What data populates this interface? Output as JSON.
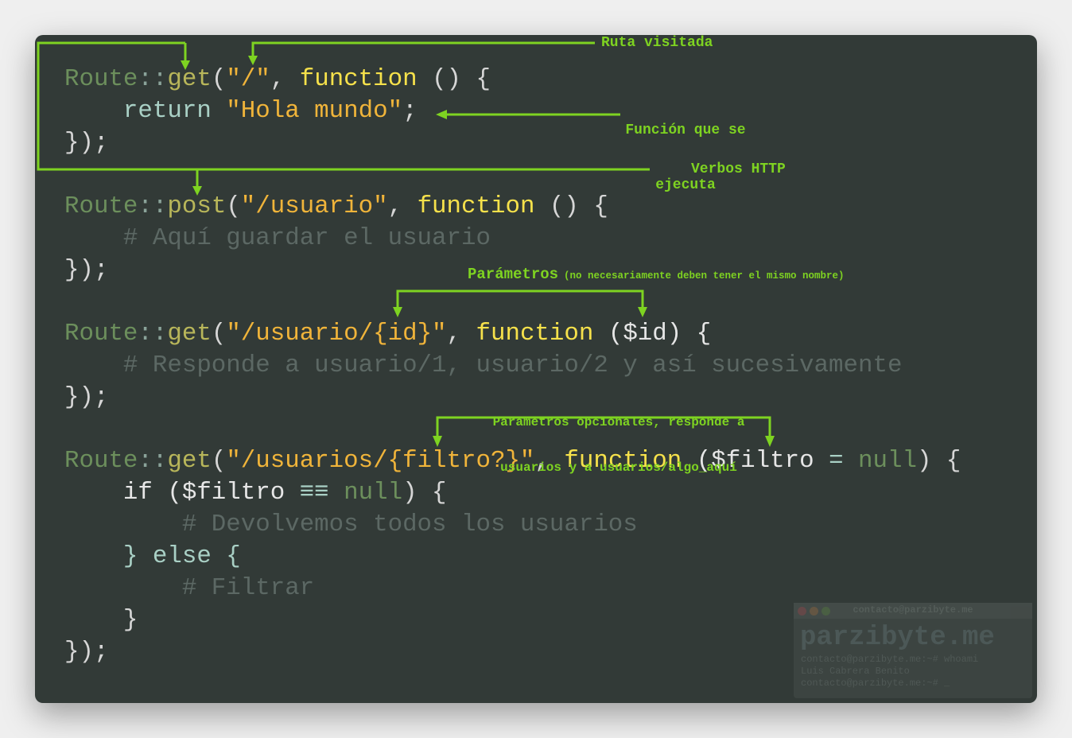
{
  "code_lines": [
    [
      [
        "Route",
        "route"
      ],
      [
        "::",
        "sep"
      ],
      [
        "get",
        "method"
      ],
      [
        "(",
        "punc"
      ],
      [
        "\"/\"",
        "str"
      ],
      [
        ", ",
        "punc"
      ],
      [
        "function",
        "kw"
      ],
      [
        " () {",
        "punc"
      ]
    ],
    [
      [
        "    return ",
        "ret"
      ],
      [
        "\"Hola mundo\"",
        "str"
      ],
      [
        ";",
        "punc"
      ]
    ],
    [
      [
        "});",
        "punc"
      ]
    ],
    [],
    [
      [
        "Route",
        "route"
      ],
      [
        "::",
        "sep"
      ],
      [
        "post",
        "method"
      ],
      [
        "(",
        "punc"
      ],
      [
        "\"/usuario\"",
        "str"
      ],
      [
        ", ",
        "punc"
      ],
      [
        "function",
        "kw"
      ],
      [
        " () {",
        "punc"
      ]
    ],
    [
      [
        "    # Aquí guardar el usuario",
        "cmt"
      ]
    ],
    [
      [
        "});",
        "punc"
      ]
    ],
    [],
    [
      [
        "Route",
        "route"
      ],
      [
        "::",
        "sep"
      ],
      [
        "get",
        "method"
      ],
      [
        "(",
        "punc"
      ],
      [
        "\"/usuario/{id}\"",
        "str"
      ],
      [
        ", ",
        "punc"
      ],
      [
        "function",
        "kw"
      ],
      [
        " ($id) {",
        "var"
      ]
    ],
    [
      [
        "    # Responde a usuario/1, usuario/2 y así sucesivamente",
        "cmt"
      ]
    ],
    [
      [
        "});",
        "punc"
      ]
    ],
    [],
    [
      [
        "Route",
        "route"
      ],
      [
        "::",
        "sep"
      ],
      [
        "get",
        "method"
      ],
      [
        "(",
        "punc"
      ],
      [
        "\"/usuarios/{filtro?}\"",
        "str"
      ],
      [
        ", ",
        "punc"
      ],
      [
        "function",
        "kw"
      ],
      [
        " ($filtro ",
        "var"
      ],
      [
        "=",
        "op"
      ],
      [
        " ",
        "punc"
      ],
      [
        "null",
        "null"
      ],
      [
        ") {",
        "punc"
      ]
    ],
    [
      [
        "    if ($filtro ",
        "var"
      ],
      [
        "≡≡",
        "op"
      ],
      [
        " ",
        "punc"
      ],
      [
        "null",
        "null"
      ],
      [
        ") {",
        "punc"
      ]
    ],
    [
      [
        "        # Devolvemos todos los usuarios",
        "cmt"
      ]
    ],
    [
      [
        "    } else {",
        "ret"
      ]
    ],
    [
      [
        "        # Filtrar",
        "cmt"
      ]
    ],
    [
      [
        "    }",
        "punc"
      ]
    ],
    [
      [
        "});",
        "punc"
      ]
    ]
  ],
  "annotations": {
    "ruta": "Ruta visitada",
    "funcion_1": "Función que se",
    "funcion_2": "ejecuta",
    "verbos": "Verbos HTTP",
    "parametros": "Parámetros",
    "parametros_note": "(no necesariamente deben tener el mismo nombre)",
    "opcionales_1": "Parámetros opcionales, responde a",
    "opcionales_2": "usuarios y a usuarios/algo_aquí"
  },
  "watermark": {
    "title": "contacto@parzibyte.me",
    "brand": "parzibyte.me",
    "lines": [
      "contacto@parzibyte.me:~# whoami",
      "Luis Cabrera Benito",
      "contacto@parzibyte.me:~# _"
    ]
  },
  "colors": {
    "accent": "#7ed321",
    "background": "#323a37"
  }
}
